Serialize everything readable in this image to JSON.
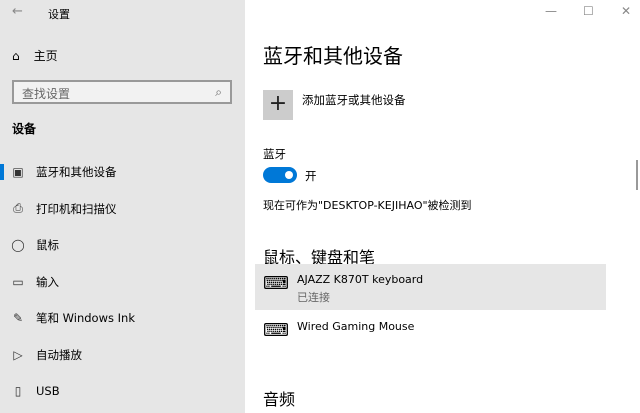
{
  "window": {
    "title": "设置",
    "back": "←",
    "minimize": "—",
    "maximize": "☐",
    "close": "✕"
  },
  "sidebar": {
    "home": "主页",
    "search_placeholder": "查找设置",
    "section": "设备",
    "items": [
      {
        "label": "蓝牙和其他设备",
        "icon": "bluetooth-devices-icon",
        "glyph": "▣",
        "selected": true
      },
      {
        "label": "打印机和扫描仪",
        "icon": "printer-icon",
        "glyph": "⎙"
      },
      {
        "label": "鼠标",
        "icon": "mouse-icon",
        "glyph": "◯"
      },
      {
        "label": "输入",
        "icon": "keyboard-icon",
        "glyph": "▭"
      },
      {
        "label": "笔和 Windows Ink",
        "icon": "pen-icon",
        "glyph": "✎"
      },
      {
        "label": "自动播放",
        "icon": "autoplay-icon",
        "glyph": "▷"
      },
      {
        "label": "USB",
        "icon": "usb-icon",
        "glyph": "▯"
      }
    ]
  },
  "main": {
    "title": "蓝牙和其他设备",
    "add_device": "添加蓝牙或其他设备",
    "bluetooth_label": "蓝牙",
    "bluetooth_state": "开",
    "bluetooth_on": true,
    "discoverable": "现在可作为\"DESKTOP-KEJIHAO\"被检测到",
    "section_input": "鼠标、键盘和笔",
    "devices": [
      {
        "name": "AJAZZ K870T keyboard",
        "status": "已连接"
      },
      {
        "name": "Wired Gaming Mouse"
      }
    ],
    "section_audio": "音频"
  }
}
